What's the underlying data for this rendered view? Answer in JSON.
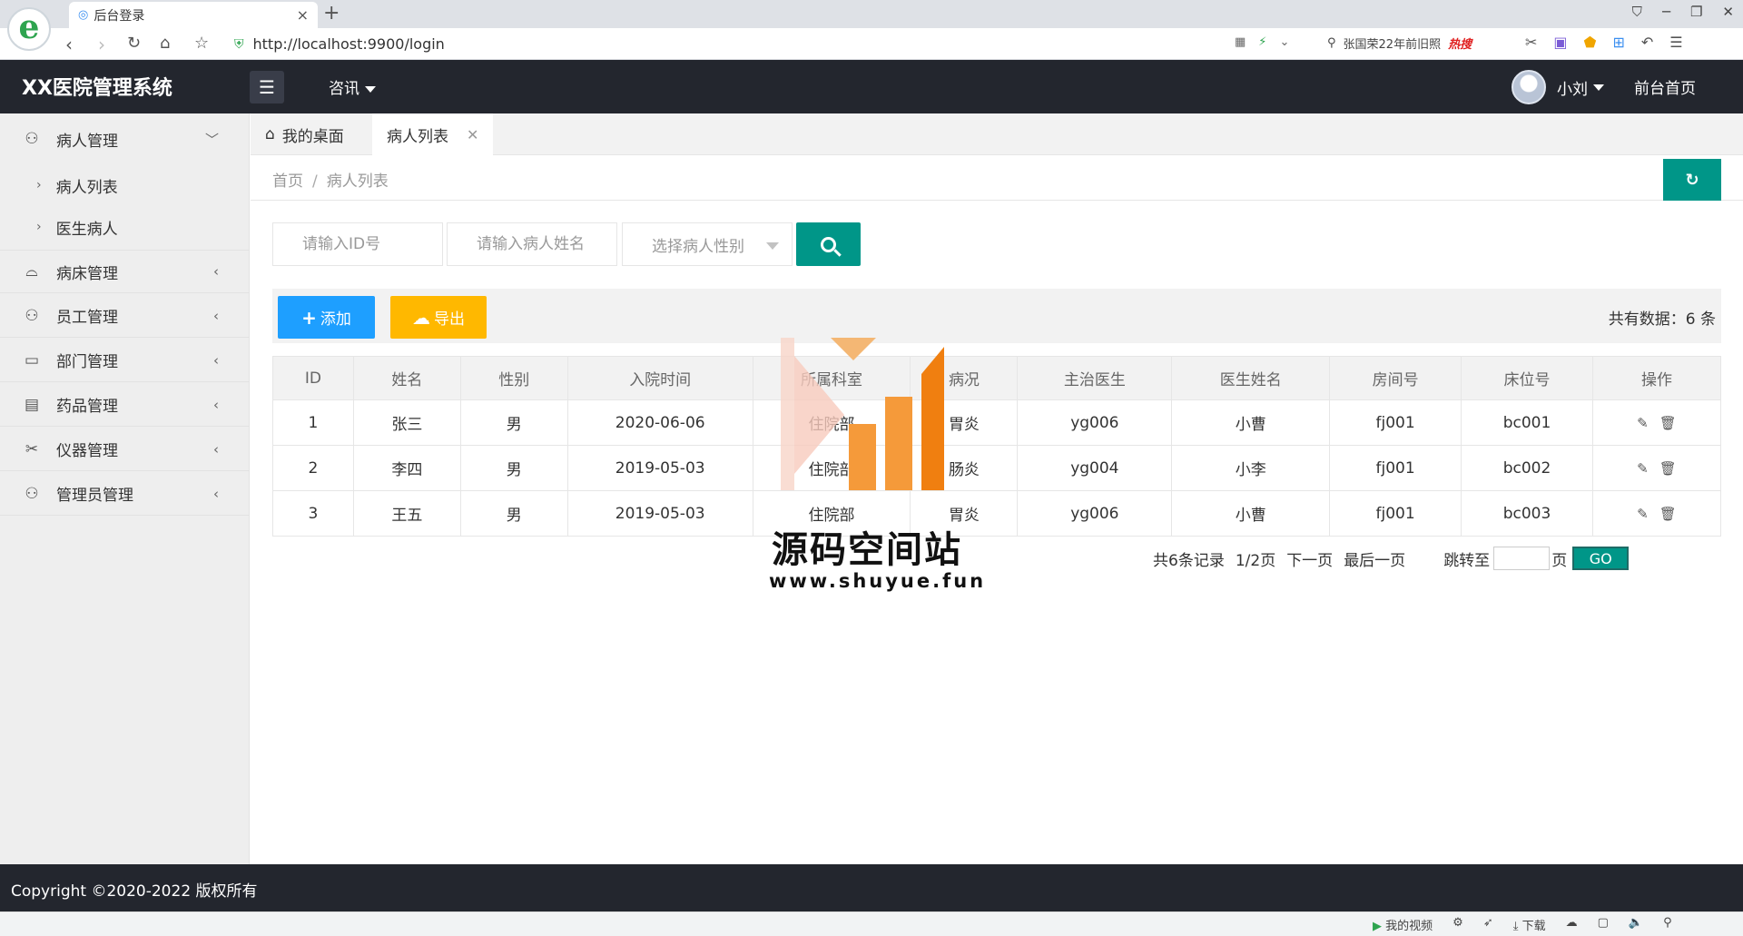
{
  "browser": {
    "logo_letter": "e",
    "tab_title": "后台登录",
    "tab_close": "×",
    "new_tab": "+",
    "url": "http://localhost:9900/login",
    "search_hint": "张国荣22年前旧照",
    "hot_label": "热搜",
    "status_video": "我的视频",
    "status_download": "下载"
  },
  "header": {
    "logo": "XX医院管理系统",
    "nav_news": "咨讯",
    "username": "小刘",
    "front_link": "前台首页"
  },
  "sidebar": {
    "items": [
      {
        "label": "病人管理",
        "icon": "user-icon",
        "expanded": true
      },
      {
        "label": "病床管理",
        "icon": "bed-icon"
      },
      {
        "label": "员工管理",
        "icon": "staff-icon"
      },
      {
        "label": "部门管理",
        "icon": "department-icon"
      },
      {
        "label": "药品管理",
        "icon": "medicine-icon"
      },
      {
        "label": "仪器管理",
        "icon": "instrument-icon"
      },
      {
        "label": "管理员管理",
        "icon": "admin-icon"
      }
    ],
    "sub_items": [
      {
        "label": "病人列表"
      },
      {
        "label": "医生病人"
      }
    ]
  },
  "content_tabs": {
    "desktop": "我的桌面",
    "patient_list": "病人列表"
  },
  "breadcrumb": {
    "home": "首页",
    "separator": "/",
    "current": "病人列表"
  },
  "search": {
    "id_placeholder": "请输入ID号",
    "name_placeholder": "请输入病人姓名",
    "gender_placeholder": "选择病人性别"
  },
  "toolbar": {
    "add_label": "添加",
    "export_label": "导出",
    "total_label": "共有数据：",
    "total_count": "6",
    "total_unit": "条"
  },
  "table": {
    "columns": [
      "ID",
      "姓名",
      "性别",
      "入院时间",
      "所属科室",
      "病况",
      "主治医生",
      "医生姓名",
      "房间号",
      "床位号",
      "操作"
    ],
    "rows": [
      [
        "1",
        "张三",
        "男",
        "2020-06-06",
        "住院部",
        "胃炎",
        "yg006",
        "小曹",
        "fj001",
        "bc001"
      ],
      [
        "2",
        "李四",
        "男",
        "2019-05-03",
        "住院部",
        "肠炎",
        "yg004",
        "小李",
        "fj001",
        "bc002"
      ],
      [
        "3",
        "王五",
        "男",
        "2019-05-03",
        "住院部",
        "胃炎",
        "yg006",
        "小曹",
        "fj001",
        "bc003"
      ]
    ]
  },
  "pager": {
    "records": "共6条记录",
    "page": "1/2页",
    "next": "下一页",
    "last": "最后一页",
    "jump_to": "跳转至",
    "page_unit": "页",
    "go": "GO"
  },
  "watermark": {
    "title": "源码空间站",
    "url": "www.shuyue.fun"
  },
  "footer": {
    "copyright": "Copyright ©2020-2022 版权所有"
  },
  "colors": {
    "header_bg": "#23262e",
    "primary": "#009688",
    "add_btn": "#1e9fff",
    "export_btn": "#ffb800",
    "sidebar_bg": "#eeeeee"
  }
}
